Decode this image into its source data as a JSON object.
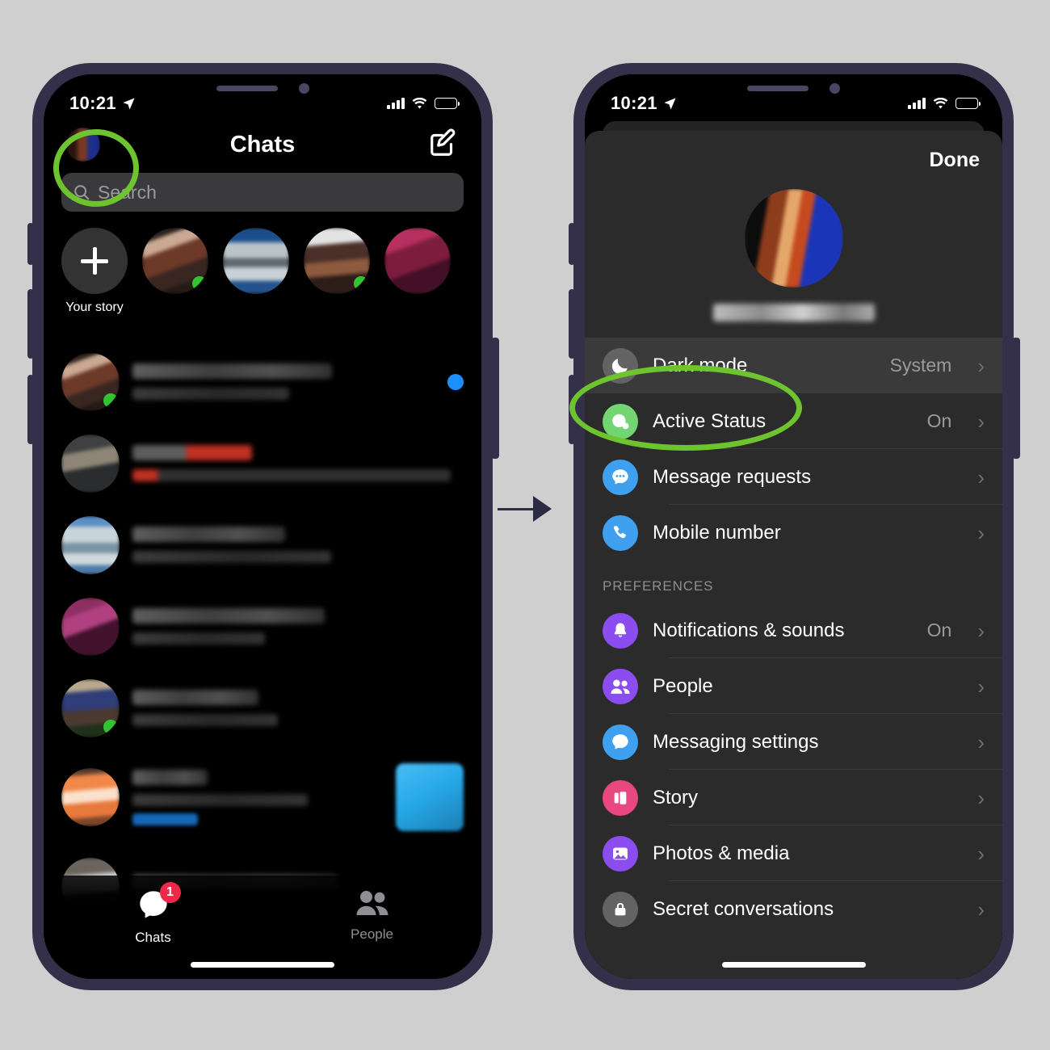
{
  "background_color": "#cfcfcf",
  "annotation_color": "#6ec42e",
  "phone_frame_color": "#353049",
  "arrow": {
    "name": "right-arrow",
    "color": "#2e2c45"
  },
  "left_phone": {
    "status_bar": {
      "time": "10:21",
      "location_icon": "location-arrow-icon",
      "signal_icon": "cellular-signal-icon",
      "wifi_icon": "wifi-icon",
      "battery_icon": "battery-low-icon",
      "battery_level": "22"
    },
    "header": {
      "title": "Chats",
      "avatar": "profile-avatar",
      "compose_icon": "compose-icon"
    },
    "search": {
      "placeholder": "Search",
      "icon": "search-icon"
    },
    "stories": {
      "add_label": "Your story",
      "add_icon": "plus-icon",
      "items": [
        {
          "name": "",
          "online": true
        },
        {
          "name": "",
          "online": false
        },
        {
          "name": "",
          "online": true
        },
        {
          "name": "",
          "online": false
        }
      ]
    },
    "chats": [
      {
        "name": "",
        "preview": "",
        "unread": true,
        "attachment": false
      },
      {
        "name": "",
        "preview": "",
        "unread": false,
        "attachment": false
      },
      {
        "name": "",
        "preview": "",
        "unread": false,
        "attachment": false
      },
      {
        "name": "",
        "preview": "",
        "unread": false,
        "attachment": false
      },
      {
        "name": "",
        "preview": "",
        "unread": false,
        "attachment": false
      },
      {
        "name": "",
        "preview": "",
        "unread": false,
        "attachment": true
      },
      {
        "name": "",
        "preview": "",
        "unread": false,
        "attachment": false
      }
    ],
    "tabbar": [
      {
        "label": "Chats",
        "icon": "chat-bubble-icon",
        "badge": "1",
        "active": true
      },
      {
        "label": "People",
        "icon": "people-icon",
        "badge": "",
        "active": false
      }
    ]
  },
  "right_phone": {
    "status_bar": {
      "time": "10:21",
      "location_icon": "location-arrow-icon",
      "signal_icon": "cellular-signal-icon",
      "wifi_icon": "wifi-icon",
      "battery_icon": "battery-low-icon",
      "battery_level": "22"
    },
    "sheet": {
      "done_label": "Done",
      "profile_name": "",
      "rows": [
        {
          "label": "Dark mode",
          "value": "System",
          "icon": "moon-icon",
          "icon_color": "#636363",
          "highlighted": true,
          "chevron": "›"
        },
        {
          "label": "Active Status",
          "value": "On",
          "icon": "active-status-icon",
          "icon_color": "#72d572",
          "highlighted": false,
          "chevron": "›"
        },
        {
          "label": "Message requests",
          "value": "",
          "icon": "message-dots-icon",
          "icon_color": "#3fa0f0",
          "highlighted": false,
          "chevron": "›"
        },
        {
          "label": "Mobile number",
          "value": "",
          "icon": "phone-icon",
          "icon_color": "#3fa0f0",
          "highlighted": false,
          "chevron": "›"
        }
      ],
      "section_header": "PREFERENCES",
      "preferences": [
        {
          "label": "Notifications & sounds",
          "value": "On",
          "icon": "bell-icon",
          "icon_color": "#8b4df0",
          "chevron": "›"
        },
        {
          "label": "People",
          "value": "",
          "icon": "people-icon",
          "icon_color": "#8b4df0",
          "chevron": "›"
        },
        {
          "label": "Messaging settings",
          "value": "",
          "icon": "chat-bubble-icon",
          "icon_color": "#3fa0f0",
          "chevron": "›"
        },
        {
          "label": "Story",
          "value": "",
          "icon": "story-icon",
          "icon_color": "#e8487f",
          "chevron": "›"
        },
        {
          "label": "Photos & media",
          "value": "",
          "icon": "photo-icon",
          "icon_color": "#8b4df0",
          "chevron": "›"
        },
        {
          "label": "Secret conversations",
          "value": "",
          "icon": "lock-icon",
          "icon_color": "#636363",
          "chevron": "›"
        }
      ]
    }
  }
}
